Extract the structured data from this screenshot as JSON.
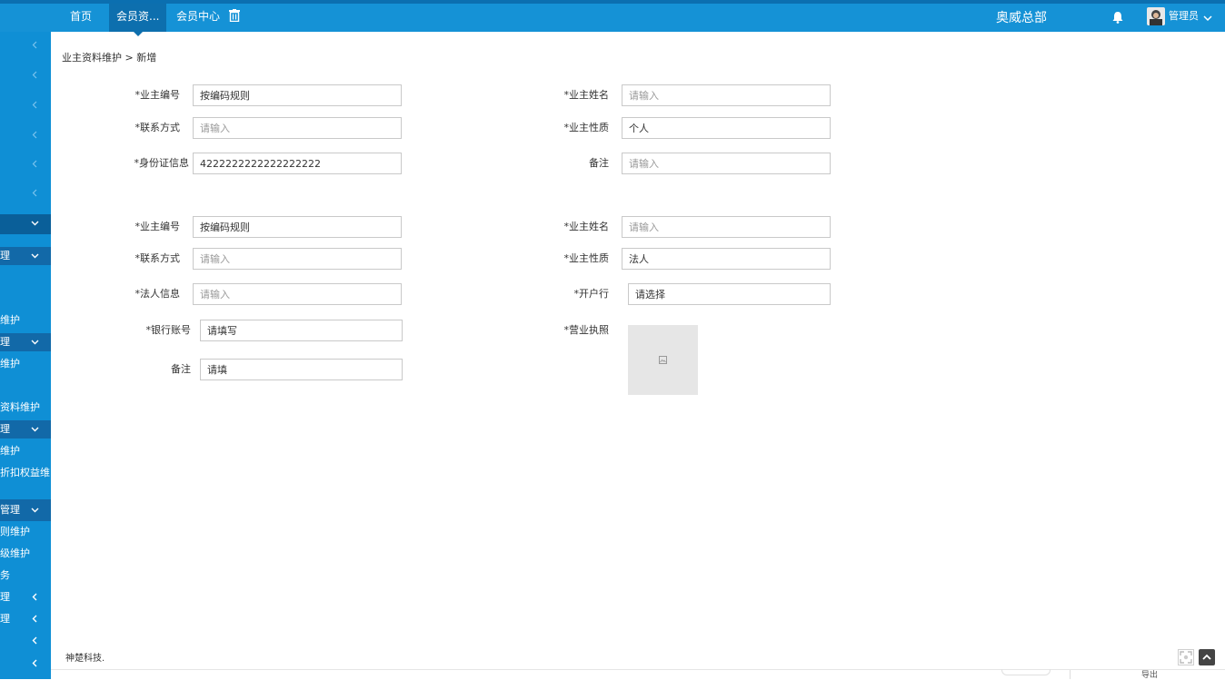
{
  "topbar": {
    "nav": [
      "首页",
      "会员资...",
      "会员中心"
    ],
    "hq": "奥威总部",
    "user": "管理员"
  },
  "sidebar": {
    "rows": [
      "",
      "",
      "",
      "",
      "",
      "",
      "",
      "理",
      "",
      "维护",
      "理",
      "维护",
      "",
      "资料维护",
      "理",
      "维护",
      "折扣权益维",
      "",
      "管理",
      "则维护",
      "级维护",
      "务",
      "理",
      "理",
      "",
      ""
    ]
  },
  "breadcrumb": "业主资料维护 > 新增",
  "section1": {
    "fields": [
      {
        "label": "*业主编号",
        "value": "按编码规则",
        "placeholder": ""
      },
      {
        "label": "*业主姓名",
        "value": "",
        "placeholder": "请输入"
      },
      {
        "label": "*联系方式",
        "value": "",
        "placeholder": "请输入"
      },
      {
        "label": "*业主性质",
        "value": "个人",
        "placeholder": ""
      },
      {
        "label": "*身份证信息",
        "value": "4222222222222222222",
        "placeholder": ""
      },
      {
        "label": "备注",
        "value": "",
        "placeholder": "请输入"
      }
    ]
  },
  "section2": {
    "fields": [
      {
        "label": "*业主编号",
        "value": "按编码规则",
        "placeholder": ""
      },
      {
        "label": "*业主姓名",
        "value": "",
        "placeholder": "请输入"
      },
      {
        "label": "*联系方式",
        "value": "",
        "placeholder": "请输入"
      },
      {
        "label": "*业主性质",
        "value": "法人",
        "placeholder": ""
      },
      {
        "label": "*法人信息",
        "value": "",
        "placeholder": "请输入"
      },
      {
        "label": "*开户行",
        "value": "请选择",
        "placeholder": ""
      },
      {
        "label": "*银行账号",
        "value": "请填写",
        "placeholder": ""
      },
      {
        "label": "*营业执照"
      },
      {
        "label": "备注",
        "value": "请填",
        "placeholder": ""
      }
    ]
  },
  "footer": {
    "company": "神楚科技.",
    "export": "导出"
  },
  "colors": {
    "topbar": "#1592d6",
    "topbar_active": "#0d6fae",
    "sidebar": "#0f8fd5",
    "sidebar_group": "#1269a8"
  }
}
